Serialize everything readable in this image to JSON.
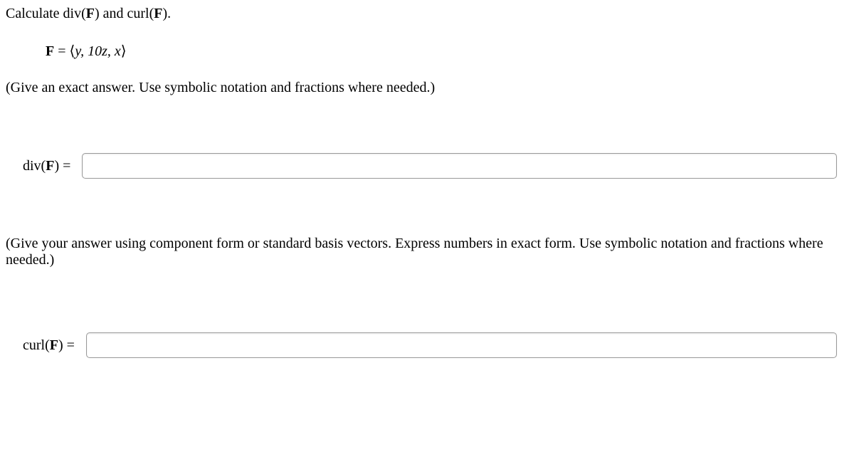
{
  "question": {
    "prompt_prefix": "Calculate div(",
    "prompt_bold1": "F",
    "prompt_mid": ") and curl(",
    "prompt_bold2": "F",
    "prompt_suffix": ")."
  },
  "equation": {
    "lhs_bold": "F",
    "eq": " = ",
    "open": "⟨",
    "content": "y, 10z, x",
    "close": "⟩"
  },
  "instruction1": "(Give an exact answer. Use symbolic notation and fractions where needed.)",
  "field1": {
    "label_prefix": "div(",
    "label_bold": "F",
    "label_suffix": ") =",
    "value": ""
  },
  "instruction2": "(Give your answer using component form or standard basis vectors. Express numbers in exact form. Use symbolic notation and fractions where needed.)",
  "field2": {
    "label_prefix": "curl(",
    "label_bold": "F",
    "label_suffix": ") =",
    "value": ""
  }
}
